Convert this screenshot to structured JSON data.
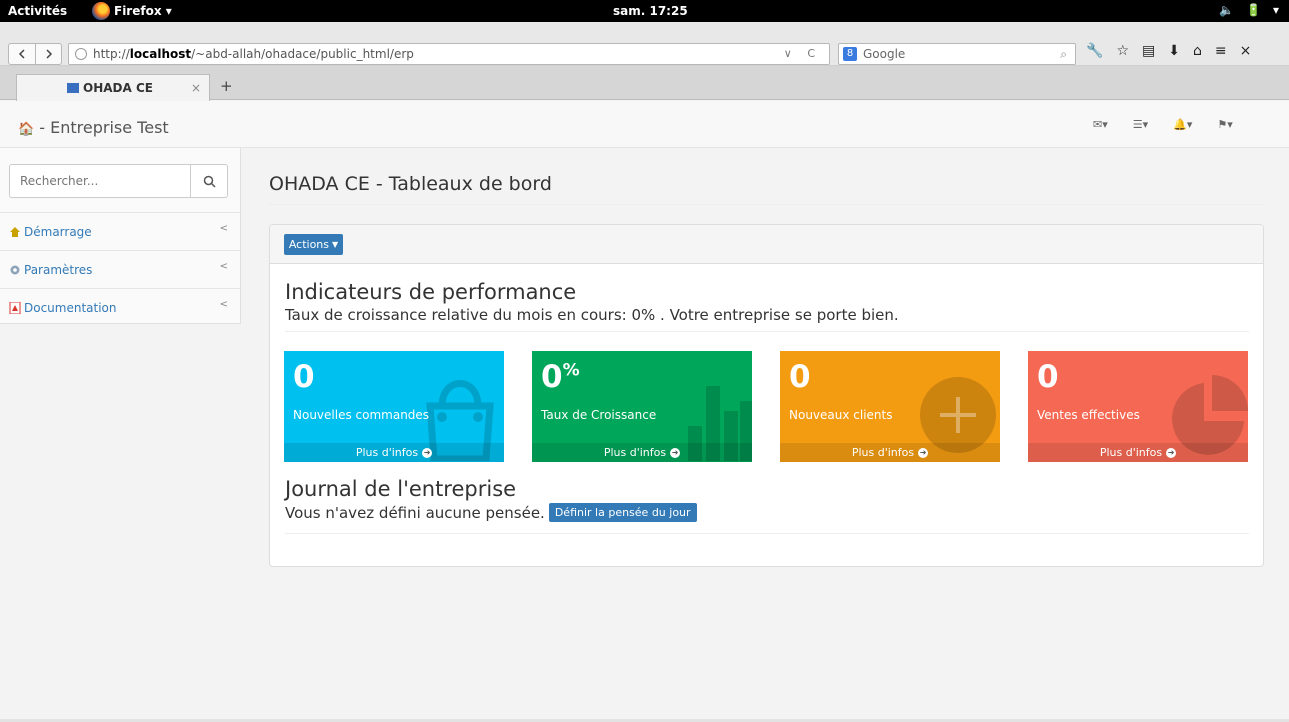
{
  "system": {
    "activities": "Activités",
    "app_name": "Firefox ▾",
    "clock": "sam. 17:25",
    "tray": [
      "🔈",
      "🔋",
      "▾"
    ]
  },
  "browser": {
    "url_prefix": "http://",
    "url_host": "localhost",
    "url_path": "/~abd-allah/ohadace/public_html/erp",
    "search_engine_label": "Google",
    "tab_title": "OHADA CE",
    "tab_close": "×",
    "new_tab": "+",
    "toolbar_glyphs": [
      "🔧",
      "☆",
      "▤",
      "⬇",
      "⌂",
      "≡",
      "×"
    ]
  },
  "app": {
    "brand_icon": "🏠",
    "brand": " - Entreprise Test",
    "header_icons": [
      {
        "name": "envelope-icon",
        "glyph": "✉▾"
      },
      {
        "name": "tasks-icon",
        "glyph": "☰▾"
      },
      {
        "name": "bell-icon",
        "glyph": "🔔▾"
      },
      {
        "name": "user-icon",
        "glyph": "⚑▾"
      }
    ]
  },
  "sidebar": {
    "search_placeholder": "Rechercher...",
    "items": [
      {
        "label": "Démarrage",
        "icon": "home-icon",
        "icon_color": "#c8a000"
      },
      {
        "label": "Paramètres",
        "icon": "gear-icon",
        "icon_color": "#7a8ca0"
      },
      {
        "label": "Documentation",
        "icon": "pdf-icon",
        "icon_color": "#d9362b"
      }
    ]
  },
  "main": {
    "page_title": "OHADA CE - Tableaux de bord",
    "actions_label": "Actions",
    "kpi_title": "Indicateurs de performance",
    "kpi_subtitle": "Taux de croissance relative du mois en cours: 0% . Votre entreprise se porte bien.",
    "boxes": [
      {
        "value": "0",
        "suffix": "",
        "label": "Nouvelles commandes",
        "more": "Plus d'infos",
        "color": "#00c0ef",
        "icon": "shopping-bag-icon"
      },
      {
        "value": "0",
        "suffix": "%",
        "label": "Taux de Croissance",
        "more": "Plus d'infos",
        "color": "#00a65a",
        "icon": "bar-chart-icon"
      },
      {
        "value": "0",
        "suffix": "",
        "label": "Nouveaux clients",
        "more": "Plus d'infos",
        "color": "#f39c12",
        "icon": "user-add-icon"
      },
      {
        "value": "0",
        "suffix": "",
        "label": "Ventes effectives",
        "more": "Plus d'infos",
        "color": "#f56954",
        "icon": "pie-chart-icon"
      }
    ],
    "journal_title": "Journal de l'entreprise",
    "journal_text": "Vous n'avez défini aucune pensée.",
    "journal_button": "Définir la pensée du jour"
  }
}
